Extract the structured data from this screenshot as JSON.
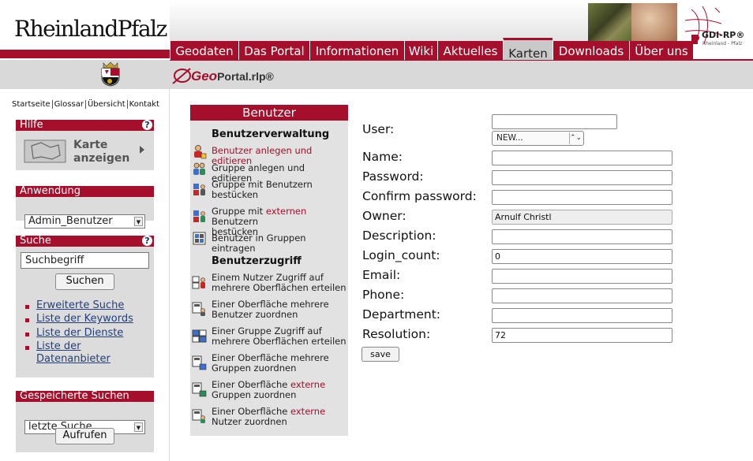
{
  "brand": {
    "logo_text": "RheinlandPfalz",
    "portal_logo_geo": "Geo",
    "portal_logo_rest": "Portal.rlp®",
    "partner_logo": "GDI-RP®",
    "partner_sub": "Rheinland - Pfalz"
  },
  "main_nav": {
    "tabs": [
      {
        "label": "Geodaten"
      },
      {
        "label": "Das Portal"
      },
      {
        "label": "Informationen"
      },
      {
        "label": "Wiki"
      },
      {
        "label": "Aktuelles"
      },
      {
        "label": "Karten",
        "active": true
      },
      {
        "label": "Downloads"
      },
      {
        "label": "Über uns"
      }
    ]
  },
  "meta_nav": {
    "items": [
      "Startseite",
      "Glossar",
      "Übersicht",
      "Kontakt"
    ]
  },
  "sidebar": {
    "hilfe": {
      "title": "Hilfe",
      "help": "?",
      "map_button_line1": "Karte",
      "map_button_line2": "anzeigen"
    },
    "anwendung": {
      "title": "Anwendung",
      "selected": "Admin_Benutzer"
    },
    "suche": {
      "title": "Suche",
      "help": "?",
      "input_value": "Suchbegriff",
      "button": "Suchen",
      "links": [
        "Erweiterte Suche",
        "Liste der Keywords",
        "Liste der Dienste",
        "Liste der",
        "Datenanbieter"
      ]
    },
    "gespeichert": {
      "title": "Gespeicherte Suchen",
      "selected": "letzte Suche",
      "button": "Aufrufen"
    }
  },
  "menu": {
    "title": "Benutzer",
    "section1": "Benutzerverwaltung",
    "section2": "Benutzerzugriff",
    "items": [
      {
        "l1": "Benutzer anlegen und editieren"
      },
      {
        "l1": "Gruppe anlegen und editieren"
      },
      {
        "l1": "Gruppe mit Benutzern",
        "l2": "bestücken"
      },
      {
        "l1a": "Gruppe mit ",
        "l1red": "externen",
        "l1b": " Benutzern",
        "l2": "bestücken"
      },
      {
        "l1": "Benutzer in Gruppen eintragen"
      },
      {
        "l1": "Einem Nutzer Zugriff auf",
        "l2": "mehrere Oberflächen erteilen"
      },
      {
        "l1": "Einer Oberfläche mehrere",
        "l2": "Benutzer zuordnen"
      },
      {
        "l1": "Einer Gruppe Zugriff auf",
        "l2": "mehrere Oberflächen erteilen"
      },
      {
        "l1": "Einer Oberfläche mehrere",
        "l2": "Gruppen zuordnen"
      },
      {
        "l1a": "Einer Oberfläche ",
        "l1red": "externe",
        "l2": "Gruppen zuordnen"
      },
      {
        "l1a": "Einer Oberfläche ",
        "l1red": "externe",
        "l2": "Nutzer zuordnen"
      }
    ]
  },
  "form": {
    "user_label": "User:",
    "user_value": "",
    "user_select": "NEW...",
    "fields": [
      {
        "label": "Name:",
        "value": ""
      },
      {
        "label": "Password:",
        "value": ""
      },
      {
        "label": "Confirm password:",
        "value": ""
      },
      {
        "label": "Owner:",
        "value": "Arnulf Christl"
      },
      {
        "label": "Description:",
        "value": ""
      },
      {
        "label": "Login_count:",
        "value": "0"
      },
      {
        "label": "Email:",
        "value": ""
      },
      {
        "label": "Phone:",
        "value": ""
      },
      {
        "label": "Department:",
        "value": ""
      },
      {
        "label": "Resolution:",
        "value": "72"
      }
    ],
    "save": "save"
  },
  "colors": {
    "brand_red": "#a60f2b",
    "panel_gray": "#dcdcdc"
  }
}
